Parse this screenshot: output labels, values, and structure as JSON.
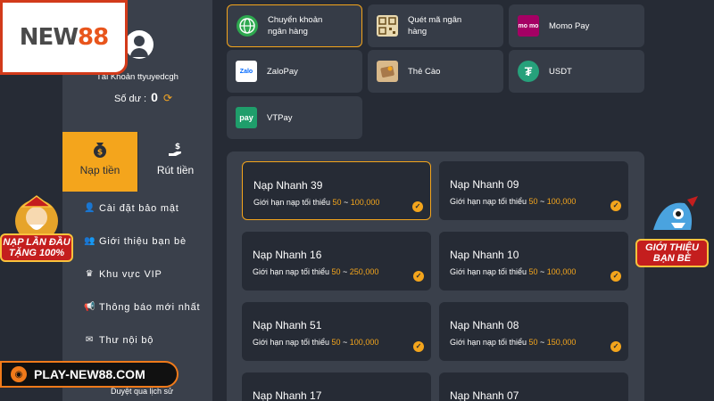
{
  "logo": {
    "text_a": "NEW",
    "text_b": "88"
  },
  "profile": {
    "account_label": "Tài Khoản ttyuyedcgh",
    "balance_label": "Số dư :",
    "balance_value": "0"
  },
  "tabs": {
    "deposit": "Nạp tiền",
    "withdraw": "Rút tiền"
  },
  "menu": [
    {
      "label": "Cài đặt bảo mật",
      "icon": "user-lock-icon"
    },
    {
      "label": "Giới thiệu bạn bè",
      "icon": "people-icon"
    },
    {
      "label": "Khu vực VIP",
      "icon": "crown-icon"
    },
    {
      "label": "Thông báo mới nhất",
      "icon": "megaphone-icon"
    },
    {
      "label": "Thư nội bộ",
      "icon": "mail-icon"
    }
  ],
  "history_label": "Duyệt qua lịch sử",
  "promo_left": {
    "line1": "NẠP LẦN ĐẦU",
    "line2": "TẶNG 100%"
  },
  "promo_right": {
    "line1": "GIỚI THIỆU",
    "line2": "BẠN BÈ"
  },
  "site_url": "PLAY-NEW88.COM",
  "payment_methods": [
    {
      "label": "Chuyển khoản\nngân hàng",
      "icon": "globe-icon",
      "active": true
    },
    {
      "label": "Quét mã ngân\nhàng",
      "icon": "qr-code-icon",
      "active": false
    },
    {
      "label": "Momo Pay",
      "icon": "momo-icon",
      "icon_text": "mo\nmo",
      "active": false
    },
    {
      "label": "ZaloPay",
      "icon": "zalopay-icon",
      "icon_text": "Zalo",
      "active": false
    },
    {
      "label": "Thẻ Cào",
      "icon": "scratch-card-icon",
      "active": false
    },
    {
      "label": "USDT",
      "icon": "tether-icon",
      "icon_text": "₮",
      "active": false
    },
    {
      "label": "VTPay",
      "icon": "vtpay-icon",
      "icon_text": "pay",
      "active": false
    }
  ],
  "quick_deposits": [
    {
      "name": "Nạp Nhanh 39",
      "limit_prefix": "Giới hạn nạp tối thiểu",
      "min": "50",
      "sep": "~",
      "max": "100,000",
      "selected": true
    },
    {
      "name": "Nạp Nhanh 09",
      "limit_prefix": "Giới hạn nạp tối thiểu",
      "min": "50",
      "sep": "~",
      "max": "100,000",
      "selected": false
    },
    {
      "name": "Nạp Nhanh 16",
      "limit_prefix": "Giới hạn nạp tối thiểu",
      "min": "50",
      "sep": "~",
      "max": "250,000",
      "selected": false
    },
    {
      "name": "Nạp Nhanh 10",
      "limit_prefix": "Giới hạn nạp tối thiểu",
      "min": "50",
      "sep": "~",
      "max": "100,000",
      "selected": false
    },
    {
      "name": "Nạp Nhanh 51",
      "limit_prefix": "Giới hạn nạp tối thiểu",
      "min": "50",
      "sep": "~",
      "max": "100,000",
      "selected": false
    },
    {
      "name": "Nạp Nhanh 08",
      "limit_prefix": "Giới hạn nạp tối thiểu",
      "min": "50",
      "sep": "~",
      "max": "150,000",
      "selected": false
    },
    {
      "name": "Nạp Nhanh 17",
      "limit_prefix": "",
      "min": "",
      "sep": "",
      "max": "",
      "selected": false
    },
    {
      "name": "Nạp Nhanh 07",
      "limit_prefix": "",
      "min": "",
      "sep": "",
      "max": "",
      "selected": false
    }
  ],
  "colors": {
    "accent": "#f4a51c",
    "panel": "#3a404b",
    "bg": "#262b35",
    "card": "#363c47"
  }
}
